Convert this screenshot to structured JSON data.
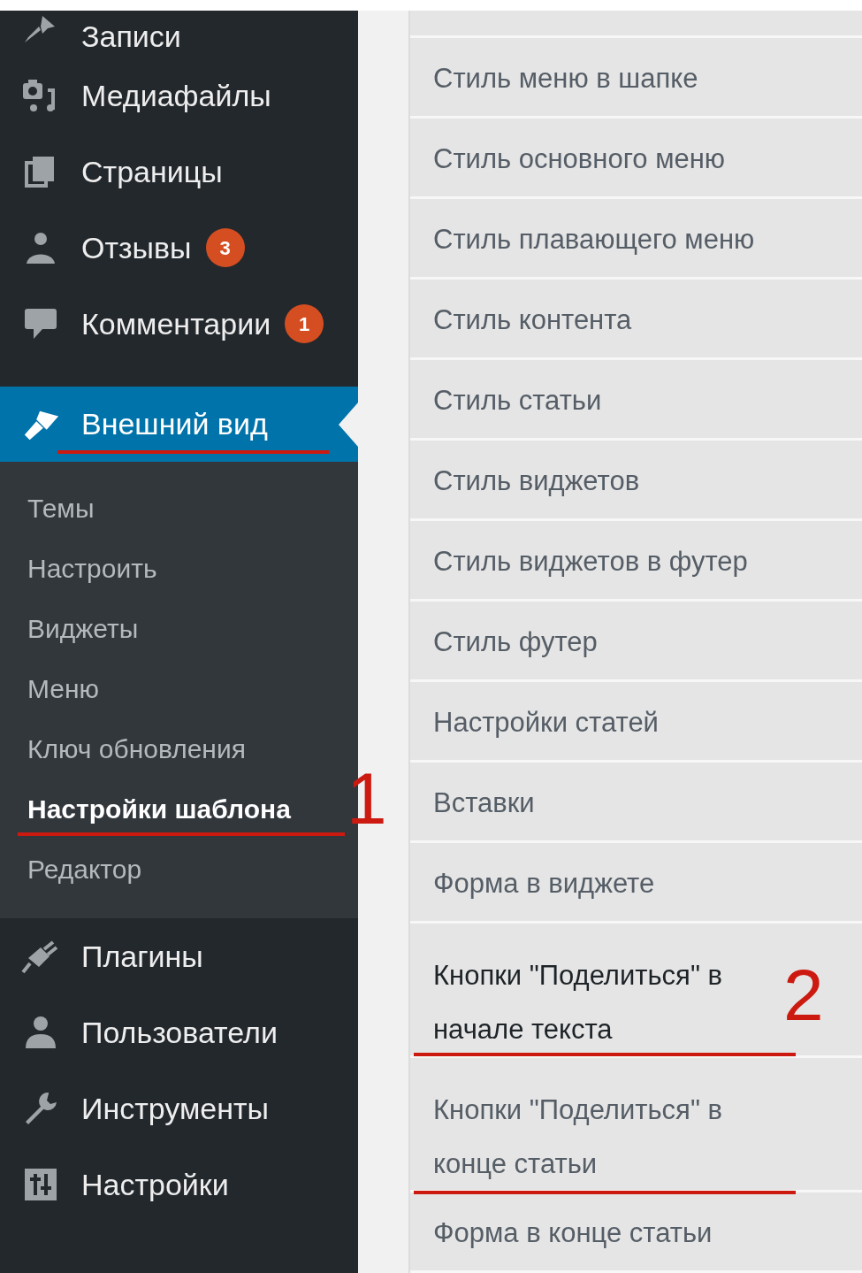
{
  "sidebar": {
    "items": [
      {
        "label": "Записи",
        "selected": false
      },
      {
        "label": "Медиафайлы",
        "selected": false
      },
      {
        "label": "Страницы",
        "selected": false
      },
      {
        "label": "Отзывы",
        "badge": "3",
        "selected": false
      },
      {
        "label": "Комментарии",
        "badge": "1",
        "selected": false
      },
      {
        "label": "Внешний вид",
        "selected": true,
        "children": [
          {
            "label": "Темы",
            "selected": false
          },
          {
            "label": "Настроить",
            "selected": false
          },
          {
            "label": "Виджеты",
            "selected": false
          },
          {
            "label": "Меню",
            "selected": false
          },
          {
            "label": "Ключ обновления",
            "selected": false
          },
          {
            "label": "Настройки шаблона",
            "selected": true
          },
          {
            "label": "Редактор",
            "selected": false
          }
        ]
      },
      {
        "label": "Плагины",
        "selected": false
      },
      {
        "label": "Пользователи",
        "selected": false
      },
      {
        "label": "Инструменты",
        "selected": false
      },
      {
        "label": "Настройки",
        "selected": false
      }
    ]
  },
  "settings_sections": [
    {
      "label": "Стиль меню в шапке",
      "selected": false
    },
    {
      "label": "Стиль основного меню",
      "selected": false
    },
    {
      "label": "Стиль плавающего меню",
      "selected": false
    },
    {
      "label": "Стиль контента",
      "selected": false
    },
    {
      "label": "Стиль статьи",
      "selected": false
    },
    {
      "label": "Стиль виджетов",
      "selected": false
    },
    {
      "label": "Стиль виджетов в футер",
      "selected": false
    },
    {
      "label": "Стиль футер",
      "selected": false
    },
    {
      "label": "Настройки статей",
      "selected": false
    },
    {
      "label": "Вставки",
      "selected": false
    },
    {
      "label": "Форма в виджете",
      "selected": false
    },
    {
      "label": "Кнопки \"Поделиться\" в начале текста",
      "selected": true
    },
    {
      "label": "Кнопки \"Поделиться\" в конце статьи",
      "selected": false
    },
    {
      "label": "Форма в конце статьи",
      "selected": false
    }
  ],
  "annotations": [
    {
      "label": "1"
    },
    {
      "label": "2"
    }
  ]
}
